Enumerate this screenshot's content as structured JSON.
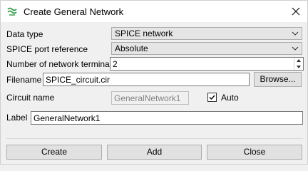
{
  "window": {
    "title": "Create General Network",
    "app_icon": "network-app-icon",
    "close_icon": "close-icon"
  },
  "form": {
    "data_type": {
      "label": "Data type",
      "value": "SPICE network"
    },
    "port_reference": {
      "label": "SPICE port reference",
      "value": "Absolute"
    },
    "terminals": {
      "label": "Number of network terminals",
      "value": "2"
    },
    "filename": {
      "label": "Filename",
      "value": "SPICE_circuit.cir",
      "browse_label": "Browse..."
    },
    "circuit_name": {
      "label": "Circuit name",
      "value": "GeneralNetwork1",
      "auto_label": "Auto",
      "auto_checked": true
    },
    "label": {
      "label": "Label",
      "value": "GeneralNetwork1"
    }
  },
  "buttons": {
    "create": "Create",
    "add": "Add",
    "close": "Close"
  },
  "colors": {
    "icon_green": "#2e9b4a",
    "window_bg": "#f0f0f0",
    "titlebar_bg": "#ffffff"
  }
}
